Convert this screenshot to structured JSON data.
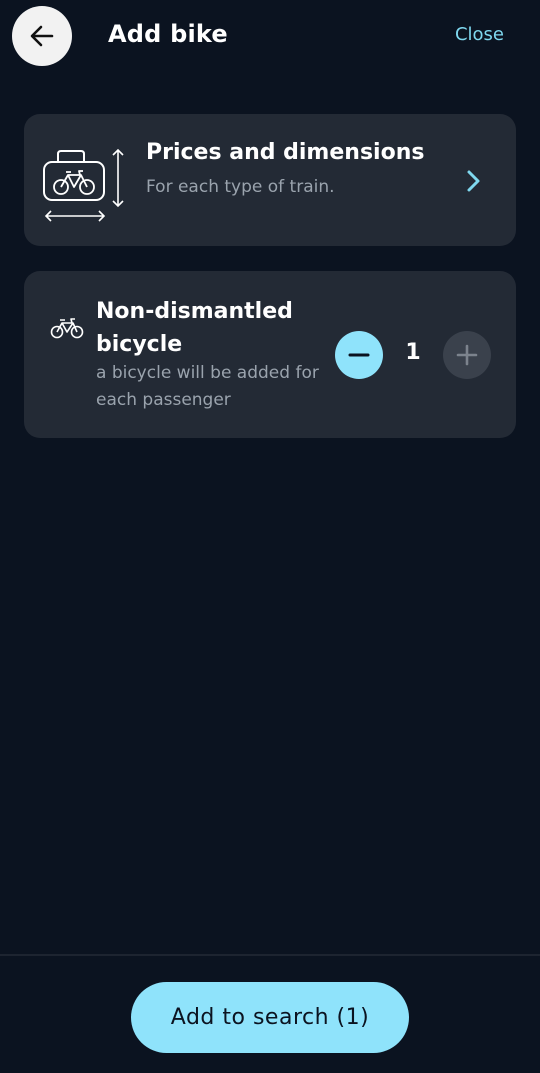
{
  "header": {
    "title": "Add bike",
    "close_label": "Close",
    "back_icon": "arrow-left-icon"
  },
  "prices_card": {
    "title": "Prices and dimensions",
    "subtitle": "For each type of train.",
    "illustration_icon": "bike-luggage-dimensions-icon",
    "chevron_icon": "chevron-right-icon"
  },
  "bike_card": {
    "icon": "bicycle-icon",
    "title": "Non-dismantled bicycle",
    "subtitle": "a bicycle will be added for each passenger",
    "quantity": "1",
    "minus_icon": "minus-icon",
    "plus_icon": "plus-icon"
  },
  "footer": {
    "cta_label": "Add to search (1)"
  },
  "colors": {
    "background": "#0b1320",
    "card": "#232a35",
    "accent": "#8fe3fb",
    "link": "#7fd8ef",
    "muted_text": "#9aa3ad",
    "disabled_button": "#3a414c"
  }
}
